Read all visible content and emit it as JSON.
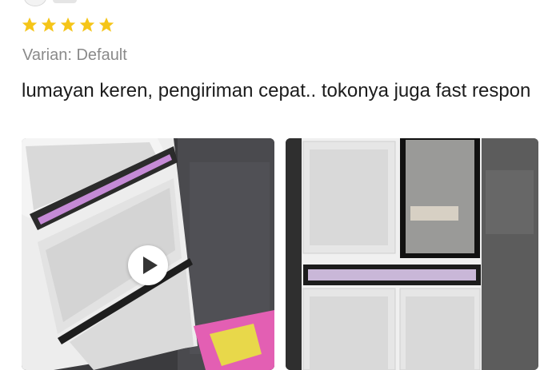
{
  "review": {
    "rating": 5,
    "rating_max": 5,
    "star_color": "#f5c518",
    "variant": "Varian: Default",
    "text": "lumayan keren, pengiriman cepat.. tokonya juga fast respon"
  },
  "media": [
    {
      "kind": "video",
      "icon": "play-icon"
    },
    {
      "kind": "photo"
    }
  ]
}
